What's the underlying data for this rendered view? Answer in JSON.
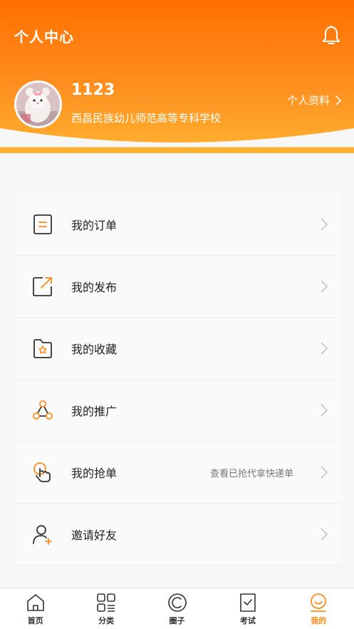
{
  "header": {
    "title": "个人中心",
    "username": "1123",
    "school": "西昌民族幼儿师范高等专科学校",
    "profile_link": "个人资料"
  },
  "menu": {
    "items": [
      {
        "label": "我的订单",
        "icon": "order-icon",
        "hint": ""
      },
      {
        "label": "我的发布",
        "icon": "publish-icon",
        "hint": ""
      },
      {
        "label": "我的收藏",
        "icon": "favorite-folder-icon",
        "hint": ""
      },
      {
        "label": "我的推广",
        "icon": "share-network-icon",
        "hint": ""
      },
      {
        "label": "我的抢单",
        "icon": "tap-hand-icon",
        "hint": "查看已抢代拿快递单"
      },
      {
        "label": "邀请好友",
        "icon": "add-user-icon",
        "hint": ""
      }
    ]
  },
  "tabbar": {
    "tabs": [
      {
        "label": "首页",
        "icon": "home-icon"
      },
      {
        "label": "分类",
        "icon": "category-grid-icon"
      },
      {
        "label": "圈子",
        "icon": "circle-icon"
      },
      {
        "label": "考试",
        "icon": "exam-icon"
      },
      {
        "label": "我的",
        "icon": "profile-smile-icon",
        "active": true
      }
    ]
  },
  "colors": {
    "accent": "#ff8a1a",
    "header_top": "#ff6f00",
    "header_bottom": "#ffb22f",
    "icon_outline": "#333333"
  }
}
